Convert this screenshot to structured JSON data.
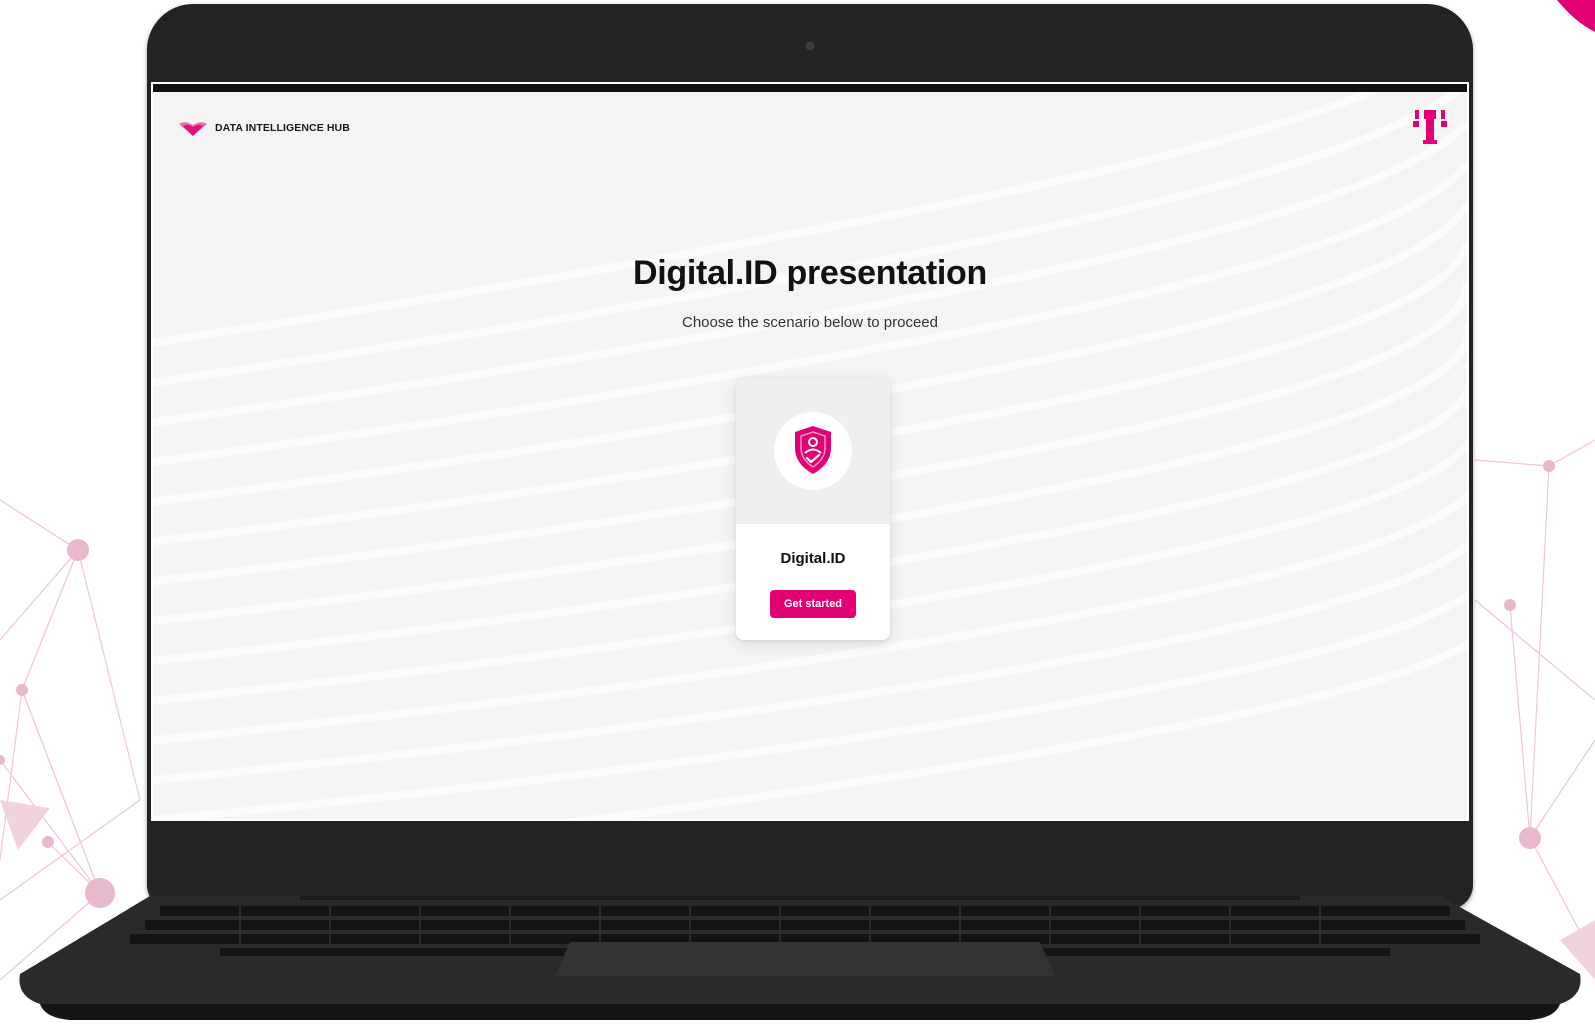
{
  "brand": {
    "name": "DATA INTELLIGENCE HUB",
    "accent_color": "#e20074"
  },
  "header": {
    "right_logo": "telekom-t-logo"
  },
  "main": {
    "title": "Digital.ID presentation",
    "subtitle": "Choose the scenario below to proceed"
  },
  "scenarios": [
    {
      "label": "Digital.ID",
      "icon": "shield-user-check-icon",
      "button_label": "Get started"
    }
  ]
}
